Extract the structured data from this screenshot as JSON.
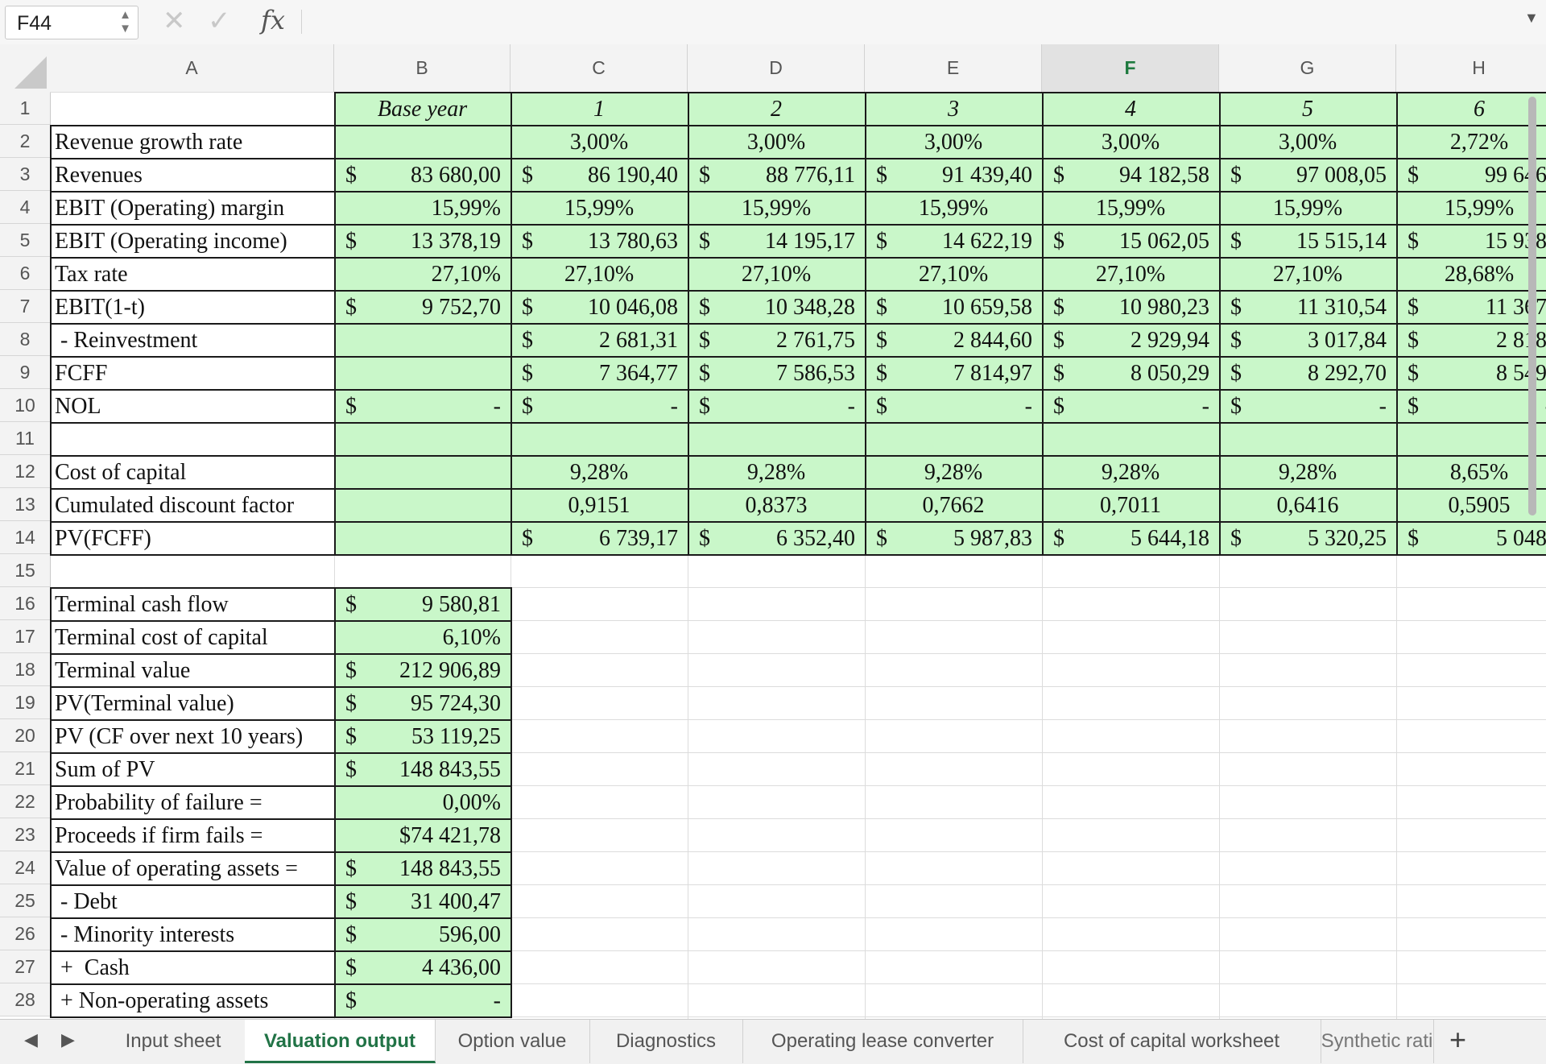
{
  "formula_bar": {
    "name_box": "F44",
    "formula": "",
    "icons": [
      "cancel-icon",
      "confirm-icon",
      "function-icon",
      "dropdown-icon"
    ]
  },
  "columns": [
    "A",
    "B",
    "C",
    "D",
    "E",
    "F",
    "G",
    "H"
  ],
  "active_column": "F",
  "rows": [
    {
      "n": "1",
      "label": "",
      "vals": [
        "Base year",
        "1",
        "2",
        "3",
        "4",
        "5",
        "6"
      ],
      "kinds": [
        "hdr",
        "hdr",
        "hdr",
        "hdr",
        "hdr",
        "hdr",
        "hdr"
      ],
      "dollar": [
        false,
        false,
        false,
        false,
        false,
        false,
        false
      ]
    },
    {
      "n": "2",
      "label": "Revenue growth rate",
      "vals": [
        "",
        "3,00%",
        "3,00%",
        "3,00%",
        "3,00%",
        "3,00%",
        "2,72%"
      ],
      "kinds": [
        "c",
        "c",
        "c",
        "c",
        "c",
        "c",
        "c"
      ],
      "dollar": [
        false,
        false,
        false,
        false,
        false,
        false,
        false
      ]
    },
    {
      "n": "3",
      "label": "Revenues",
      "vals": [
        "83 680,00",
        "86 190,40",
        "88 776,11",
        "91 439,40",
        "94 182,58",
        "97 008,05",
        "99 646,"
      ],
      "kinds": [
        "r",
        "r",
        "r",
        "r",
        "r",
        "r",
        "r"
      ],
      "dollar": [
        true,
        true,
        true,
        true,
        true,
        true,
        true
      ]
    },
    {
      "n": "4",
      "label": "EBIT (Operating) margin",
      "vals": [
        "15,99%",
        "15,99%",
        "15,99%",
        "15,99%",
        "15,99%",
        "15,99%",
        "15,99%"
      ],
      "kinds": [
        "r",
        "c",
        "c",
        "c",
        "c",
        "c",
        "c"
      ],
      "dollar": [
        false,
        false,
        false,
        false,
        false,
        false,
        false
      ]
    },
    {
      "n": "5",
      "label": "EBIT (Operating income)",
      "vals": [
        "13 378,19",
        "13 780,63",
        "14 195,17",
        "14 622,19",
        "15 062,05",
        "15 515,14",
        "15 938,"
      ],
      "kinds": [
        "r",
        "r",
        "r",
        "r",
        "r",
        "r",
        "r"
      ],
      "dollar": [
        true,
        true,
        true,
        true,
        true,
        true,
        true
      ]
    },
    {
      "n": "6",
      "label": "Tax rate",
      "vals": [
        "27,10%",
        "27,10%",
        "27,10%",
        "27,10%",
        "27,10%",
        "27,10%",
        "28,68%"
      ],
      "kinds": [
        "r",
        "c",
        "c",
        "c",
        "c",
        "c",
        "c"
      ],
      "dollar": [
        false,
        false,
        false,
        false,
        false,
        false,
        false
      ]
    },
    {
      "n": "7",
      "label": "EBIT(1-t)",
      "vals": [
        "9 752,70",
        "10 046,08",
        "10 348,28",
        "10 659,58",
        "10 980,23",
        "11 310,54",
        "11 367,"
      ],
      "kinds": [
        "r",
        "r",
        "r",
        "r",
        "r",
        "r",
        "r"
      ],
      "dollar": [
        true,
        true,
        true,
        true,
        true,
        true,
        true
      ]
    },
    {
      "n": "8",
      "label": " - Reinvestment",
      "vals": [
        "",
        "2 681,31",
        "2 761,75",
        "2 844,60",
        "2 929,94",
        "3 017,84",
        "2 818,"
      ],
      "kinds": [
        "r",
        "r",
        "r",
        "r",
        "r",
        "r",
        "r"
      ],
      "dollar": [
        false,
        true,
        true,
        true,
        true,
        true,
        true
      ]
    },
    {
      "n": "9",
      "label": "FCFF",
      "vals": [
        "",
        "7 364,77",
        "7 586,53",
        "7 814,97",
        "8 050,29",
        "8 292,70",
        "8 549,"
      ],
      "kinds": [
        "r",
        "r",
        "r",
        "r",
        "r",
        "r",
        "r"
      ],
      "dollar": [
        false,
        true,
        true,
        true,
        true,
        true,
        true
      ]
    },
    {
      "n": "10",
      "label": "NOL",
      "vals": [
        "-",
        "-",
        "-",
        "-",
        "-",
        "-",
        "-"
      ],
      "kinds": [
        "r",
        "r",
        "r",
        "r",
        "r",
        "r",
        "r"
      ],
      "dollar": [
        true,
        true,
        true,
        true,
        true,
        true,
        true
      ]
    },
    {
      "n": "11",
      "label": "",
      "vals": [
        "",
        "",
        "",
        "",
        "",
        "",
        ""
      ],
      "kinds": [
        "r",
        "r",
        "r",
        "r",
        "r",
        "r",
        "r"
      ],
      "dollar": [
        false,
        false,
        false,
        false,
        false,
        false,
        false
      ]
    },
    {
      "n": "12",
      "label": "Cost of capital",
      "vals": [
        "",
        "9,28%",
        "9,28%",
        "9,28%",
        "9,28%",
        "9,28%",
        "8,65%"
      ],
      "kinds": [
        "c",
        "c",
        "c",
        "c",
        "c",
        "c",
        "c"
      ],
      "dollar": [
        false,
        false,
        false,
        false,
        false,
        false,
        false
      ]
    },
    {
      "n": "13",
      "label": "Cumulated discount factor",
      "vals": [
        "",
        "0,9151",
        "0,8373",
        "0,7662",
        "0,7011",
        "0,6416",
        "0,5905"
      ],
      "kinds": [
        "c",
        "c",
        "c",
        "c",
        "c",
        "c",
        "c"
      ],
      "dollar": [
        false,
        false,
        false,
        false,
        false,
        false,
        false
      ]
    },
    {
      "n": "14",
      "label": "PV(FCFF)",
      "vals": [
        "",
        "6 739,17",
        "6 352,40",
        "5 987,83",
        "5 644,18",
        "5 320,25",
        "5 048,"
      ],
      "kinds": [
        "r",
        "r",
        "r",
        "r",
        "r",
        "r",
        "r"
      ],
      "dollar": [
        false,
        true,
        true,
        true,
        true,
        true,
        true
      ]
    },
    {
      "n": "15",
      "label": "",
      "vals": [],
      "kinds": [],
      "dollar": []
    },
    {
      "n": "16",
      "label": "Terminal cash flow",
      "vals": [
        "9 580,81"
      ],
      "kinds": [
        "r"
      ],
      "dollar": [
        true
      ]
    },
    {
      "n": "17",
      "label": "Terminal cost of capital",
      "vals": [
        "6,10%"
      ],
      "kinds": [
        "r"
      ],
      "dollar": [
        false
      ]
    },
    {
      "n": "18",
      "label": "Terminal value",
      "vals": [
        "212 906,89"
      ],
      "kinds": [
        "r"
      ],
      "dollar": [
        true
      ]
    },
    {
      "n": "19",
      "label": "PV(Terminal value)",
      "vals": [
        "95 724,30"
      ],
      "kinds": [
        "r"
      ],
      "dollar": [
        true
      ]
    },
    {
      "n": "20",
      "label": "PV (CF over next 10 years)",
      "vals": [
        "53 119,25"
      ],
      "kinds": [
        "r"
      ],
      "dollar": [
        true
      ]
    },
    {
      "n": "21",
      "label": "Sum of PV",
      "vals": [
        "148 843,55"
      ],
      "kinds": [
        "r"
      ],
      "dollar": [
        true
      ]
    },
    {
      "n": "22",
      "label": "Probability of failure =",
      "vals": [
        "0,00%"
      ],
      "kinds": [
        "r"
      ],
      "dollar": [
        false
      ]
    },
    {
      "n": "23",
      "label": "Proceeds if firm fails =",
      "vals": [
        "$74 421,78"
      ],
      "kinds": [
        "r"
      ],
      "dollar": [
        false
      ]
    },
    {
      "n": "24",
      "label": "Value of operating assets =",
      "vals": [
        "148 843,55"
      ],
      "kinds": [
        "r"
      ],
      "dollar": [
        true
      ]
    },
    {
      "n": "25",
      "label": " - Debt",
      "vals": [
        "31 400,47"
      ],
      "kinds": [
        "r"
      ],
      "dollar": [
        true
      ]
    },
    {
      "n": "26",
      "label": " - Minority interests",
      "vals": [
        "596,00"
      ],
      "kinds": [
        "r"
      ],
      "dollar": [
        true
      ]
    },
    {
      "n": "27",
      "label": " +  Cash",
      "vals": [
        "4 436,00"
      ],
      "kinds": [
        "r"
      ],
      "dollar": [
        true
      ]
    },
    {
      "n": "28",
      "label": " + Non-operating assets",
      "vals": [
        "-"
      ],
      "kinds": [
        "r"
      ],
      "dollar": [
        true
      ]
    }
  ],
  "currency_symbol": "$",
  "sheet_tabs": [
    {
      "label": "Input sheet",
      "active": false
    },
    {
      "label": "Valuation output",
      "active": true
    },
    {
      "label": "Option value",
      "active": false
    },
    {
      "label": "Diagnostics",
      "active": false
    },
    {
      "label": "Operating lease converter",
      "active": false
    },
    {
      "label": "Cost of capital worksheet",
      "active": false
    },
    {
      "label": "Synthetic rati",
      "active": false
    }
  ],
  "colors": {
    "cell_fill": "#c9f7c9",
    "accent": "#217346",
    "header_bg": "#f3f3f3"
  }
}
